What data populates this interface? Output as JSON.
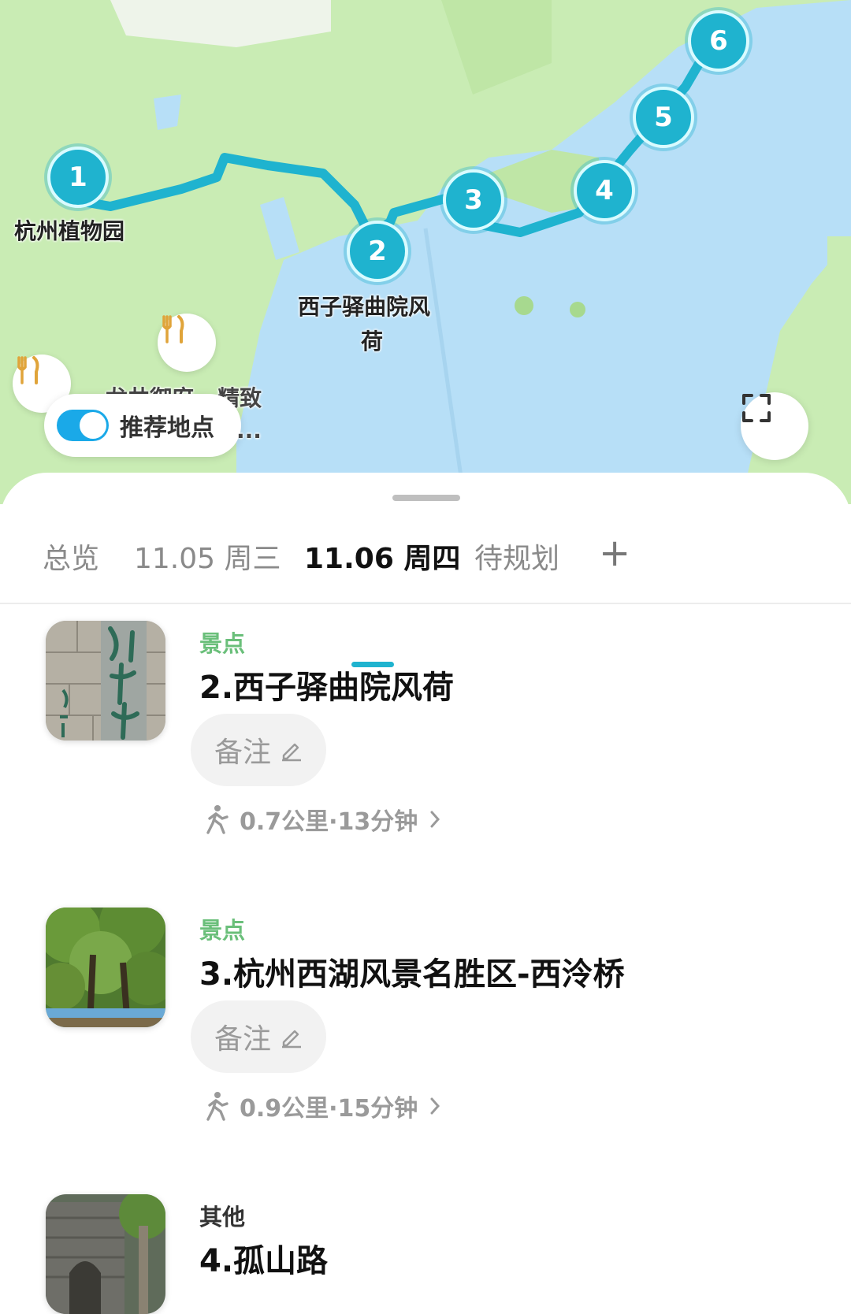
{
  "map": {
    "markers": [
      "1",
      "2",
      "3",
      "4",
      "5",
      "6"
    ],
    "labels": {
      "botanical": "杭州植物园",
      "xizi_line1": "西子驿曲院风",
      "xizi_line2": "荷",
      "restaurant_partial": "龙井御府 · 精致",
      "ellipsis": "..."
    },
    "recommend_toggle": {
      "label": "推荐地点",
      "on": true
    },
    "food_icon": "fork-knife-icon",
    "fullscreen_icon": "fullscreen-icon",
    "colors": {
      "land": "#c9ecb4",
      "water": "#b7dff7",
      "route": "#1fb3cf"
    }
  },
  "tabs": [
    "总览",
    "11.05 周三",
    "11.06 周四",
    "待规划"
  ],
  "active_tab": "11.06 周四",
  "add_tab_label": "+",
  "items": [
    {
      "category": "景点",
      "title": "2.西子驿曲院风荷",
      "note_label": "备注"
    },
    {
      "category": "景点",
      "title": "3.杭州西湖风景名胜区-西泠桥",
      "note_label": "备注"
    },
    {
      "category": "其他",
      "title": "4.孤山路"
    }
  ],
  "routes": [
    {
      "text": "0.7公里·13分钟"
    },
    {
      "text": "0.9公里·15分钟"
    }
  ],
  "colors": {
    "accent": "#1fb3cf",
    "category_scenic": "#6abf7a",
    "toggle_on": "#1aa9e8"
  }
}
